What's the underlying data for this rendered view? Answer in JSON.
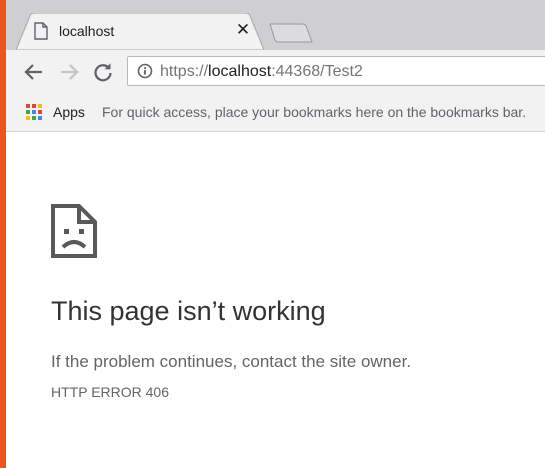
{
  "tab": {
    "title": "localhost",
    "close_glyph": "✕",
    "favicon": "page-icon"
  },
  "toolbar": {
    "back_icon": "back-arrow-icon",
    "forward_icon": "forward-arrow-icon",
    "reload_icon": "reload-icon",
    "url_scheme": "https://",
    "url_host": "localhost",
    "url_rest": ":44368/Test2",
    "security_icon": "info-icon"
  },
  "bookmarks": {
    "apps_label": "Apps",
    "hint": "For quick access, place your bookmarks here on the bookmarks bar."
  },
  "error": {
    "icon": "sad-file-icon",
    "heading": "This page isn’t working",
    "message": "If the problem continues, contact the site owner.",
    "code": "HTTP ERROR 406"
  },
  "colors": {
    "accent_left": "#f0541e",
    "tab_strip": "#cfcfd1",
    "toolbar": "#f2f2f2"
  }
}
